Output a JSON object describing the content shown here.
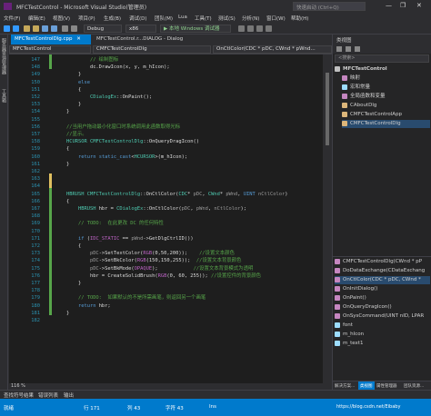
{
  "window": {
    "title": "MFCTestControl - Microsoft Visual Studio(管理员)",
    "quick_launch_placeholder": "快速启动 (Ctrl+Q)",
    "min": "—",
    "max": "❐",
    "close": "✕"
  },
  "menu": [
    "文件(F)",
    "编辑(E)",
    "视图(V)",
    "项目(P)",
    "生成(B)",
    "调试(D)",
    "团队(M)",
    "Lua",
    "工具(T)",
    "测试(S)",
    "分析(N)",
    "窗口(W)",
    "帮助(H)"
  ],
  "toolbar": {
    "config": "Debug",
    "platform": "x86",
    "debugger": "▶ 本地 Windows 调试器"
  },
  "left_strip": [
    "服务器资源管理器",
    "工具箱"
  ],
  "tabs": [
    {
      "label": "MFCTestControlDlg.cpp",
      "active": true
    },
    {
      "label": "MFCTestControl.r...DIALOG - Dialog",
      "active": false
    }
  ],
  "nav": {
    "scope": "MFCTestControl",
    "class": "CMFCTestControlDlg",
    "member": "OnCtlColor(CDC * pDC, CWnd * pWnd..."
  },
  "code_lines": [
    {
      "n": "147",
      "t": [
        [
          "cm",
          "            // 绘制图标"
        ]
      ]
    },
    {
      "n": "148",
      "t": [
        [
          "tx",
          "            dc.DrawIcon(x, y, m_hIcon);"
        ]
      ]
    },
    {
      "n": "149",
      "t": [
        [
          "tx",
          "        }"
        ]
      ]
    },
    {
      "n": "150",
      "t": [
        [
          "kw",
          "        else"
        ]
      ]
    },
    {
      "n": "151",
      "t": [
        [
          "tx",
          "        {"
        ]
      ]
    },
    {
      "n": "152",
      "t": [
        [
          "tx",
          "            "
        ],
        [
          "ty",
          "CDialogEx"
        ],
        [
          "tx",
          "::OnPaint();"
        ]
      ]
    },
    {
      "n": "153",
      "t": [
        [
          "tx",
          "        }"
        ]
      ]
    },
    {
      "n": "154",
      "t": [
        [
          "tx",
          "    }"
        ]
      ]
    },
    {
      "n": "155",
      "t": [
        [
          "tx",
          ""
        ]
      ]
    },
    {
      "n": "156",
      "t": [
        [
          "cm",
          "    //当用户拖动最小化窗口时系统调用此函数取得光标"
        ]
      ]
    },
    {
      "n": "157",
      "t": [
        [
          "cm",
          "    //显示。"
        ]
      ]
    },
    {
      "n": "158",
      "t": [
        [
          "ty",
          "    HCURSOR "
        ],
        [
          "ty",
          "CMFCTestControlDlg"
        ],
        [
          "tx",
          "::OnQueryDragIcon()"
        ]
      ]
    },
    {
      "n": "159",
      "t": [
        [
          "tx",
          "    {"
        ]
      ]
    },
    {
      "n": "160",
      "t": [
        [
          "kw",
          "        return "
        ],
        [
          "kw",
          "static_cast"
        ],
        [
          "tx",
          "<"
        ],
        [
          "ty",
          "HCURSOR"
        ],
        [
          "tx",
          ">(m_hIcon);"
        ]
      ]
    },
    {
      "n": "161",
      "t": [
        [
          "tx",
          "    }"
        ]
      ]
    },
    {
      "n": "162",
      "t": [
        [
          "tx",
          ""
        ]
      ]
    },
    {
      "n": "163",
      "t": [
        [
          "tx",
          ""
        ]
      ]
    },
    {
      "n": "164",
      "t": [
        [
          "tx",
          ""
        ]
      ]
    },
    {
      "n": "165",
      "t": [
        [
          "ty",
          "    HBRUSH "
        ],
        [
          "ty",
          "CMFCTestControlDlg"
        ],
        [
          "tx",
          "::OnCtlColor("
        ],
        [
          "ty",
          "CDC"
        ],
        [
          "tx",
          "* "
        ],
        [
          "pr",
          "pDC"
        ],
        [
          "tx",
          ", "
        ],
        [
          "ty",
          "CWnd"
        ],
        [
          "tx",
          "* "
        ],
        [
          "pr",
          "pWnd"
        ],
        [
          "tx",
          ", "
        ],
        [
          "kw",
          "UINT "
        ],
        [
          "pr",
          "nCtlColor"
        ],
        [
          "tx",
          ")"
        ]
      ]
    },
    {
      "n": "166",
      "t": [
        [
          "tx",
          "    {"
        ]
      ]
    },
    {
      "n": "167",
      "t": [
        [
          "ty",
          "        HBRUSH "
        ],
        [
          "tx",
          "hbr = "
        ],
        [
          "ty",
          "CDialogEx"
        ],
        [
          "tx",
          "::OnCtlColor("
        ],
        [
          "pr",
          "pDC"
        ],
        [
          "tx",
          ", "
        ],
        [
          "pr",
          "pWnd"
        ],
        [
          "tx",
          ", "
        ],
        [
          "pr",
          "nCtlColor"
        ],
        [
          "tx",
          ");"
        ]
      ]
    },
    {
      "n": "168",
      "t": [
        [
          "tx",
          ""
        ]
      ]
    },
    {
      "n": "169",
      "t": [
        [
          "cm",
          "        // TODO:  在此更改 DC 的任何特性"
        ]
      ]
    },
    {
      "n": "170",
      "t": [
        [
          "tx",
          ""
        ]
      ]
    },
    {
      "n": "171",
      "t": [
        [
          "kw",
          "        if "
        ],
        [
          "tx",
          "("
        ],
        [
          "mc",
          "IDC_STATIC"
        ],
        [
          "tx",
          " == "
        ],
        [
          "pr",
          "pWnd"
        ],
        [
          "tx",
          "->GetDlgCtrlID())"
        ]
      ]
    },
    {
      "n": "172",
      "t": [
        [
          "tx",
          "        {"
        ]
      ]
    },
    {
      "n": "173",
      "t": [
        [
          "pr",
          "            pDC"
        ],
        [
          "tx",
          "->SetTextColor("
        ],
        [
          "mc",
          "RGB"
        ],
        [
          "tx",
          "(0,50,200));    "
        ],
        [
          "cm",
          "//设置文本颜色"
        ]
      ]
    },
    {
      "n": "174",
      "t": [
        [
          "pr",
          "            pDC"
        ],
        [
          "tx",
          "->SetBkColor("
        ],
        [
          "mc",
          "RGB"
        ],
        [
          "tx",
          "(150,150,255));  "
        ],
        [
          "cm",
          "//设置文本背景颜色"
        ]
      ]
    },
    {
      "n": "175",
      "t": [
        [
          "pr",
          "            pDC"
        ],
        [
          "tx",
          "->SetBkMode("
        ],
        [
          "mc",
          "OPAQUE"
        ],
        [
          "tx",
          ");            "
        ],
        [
          "cm",
          "//设置文本背景模式为透明"
        ]
      ]
    },
    {
      "n": "176",
      "t": [
        [
          "tx",
          "            hbr = CreateSolidBrush("
        ],
        [
          "mc",
          "RGB"
        ],
        [
          "tx",
          "(0, 60, 255)); "
        ],
        [
          "cm",
          "//设置控件的背景颜色"
        ]
      ]
    },
    {
      "n": "177",
      "t": [
        [
          "tx",
          "        }"
        ]
      ]
    },
    {
      "n": "178",
      "t": [
        [
          "tx",
          ""
        ]
      ]
    },
    {
      "n": "179",
      "t": [
        [
          "cm",
          "        // TODO:  如果默认的不是所需画笔，则返回另一个画笔"
        ]
      ]
    },
    {
      "n": "180",
      "t": [
        [
          "kw",
          "        return "
        ],
        [
          "tx",
          "hbr;"
        ]
      ]
    },
    {
      "n": "181",
      "t": [
        [
          "tx",
          "    }"
        ]
      ]
    },
    {
      "n": "182",
      "t": [
        [
          "tx",
          ""
        ]
      ]
    }
  ],
  "zoom": "116 %",
  "class_view": {
    "header": "类视图",
    "search_placeholder": "<搜索>",
    "tree": [
      {
        "label": "MFCTestControl",
        "bold": true,
        "color": "#c0c0c0"
      },
      {
        "label": "映射",
        "color": "#c586c0"
      },
      {
        "label": "宏和常量",
        "color": "#9cdcfe"
      },
      {
        "label": "全局函数和变量",
        "color": "#c586c0"
      },
      {
        "label": "CAboutDlg",
        "color": "#dcb67a"
      },
      {
        "label": "CMFCTestControlApp",
        "color": "#dcb67a"
      },
      {
        "label": "CMFCTestControlDlg",
        "color": "#dcb67a",
        "selected": true
      }
    ],
    "members": [
      {
        "label": "CMFCTestControlDlg(CWnd * pP",
        "color": "#c586c0"
      },
      {
        "label": "DoDataExchange(CDataExchang",
        "color": "#c586c0"
      },
      {
        "label": "OnCtlColor(CDC * pDC, CWnd *",
        "color": "#c586c0",
        "selected": true
      },
      {
        "label": "OnInitDialog()",
        "color": "#c586c0"
      },
      {
        "label": "OnPaint()",
        "color": "#c586c0"
      },
      {
        "label": "OnQueryDragIcon()",
        "color": "#c586c0"
      },
      {
        "label": "OnSysCommand(UINT nID, LPAR",
        "color": "#c586c0"
      },
      {
        "label": "font",
        "color": "#9cdcfe"
      },
      {
        "label": "m_hIcon",
        "color": "#9cdcfe"
      },
      {
        "label": "m_text1",
        "color": "#9cdcfe"
      }
    ]
  },
  "bottom_tabs": [
    "查找符号结果",
    "错误列表",
    "输出"
  ],
  "right_bottom_tabs": [
    "解决方案...",
    "类视图",
    "属性管理器",
    "团队资源..."
  ],
  "status": {
    "ready": "就绪",
    "line": "行 171",
    "col": "列 43",
    "ch": "字符 43",
    "ins": "Ins",
    "watermark": "https://blog.csdn.net/Eibaby"
  }
}
